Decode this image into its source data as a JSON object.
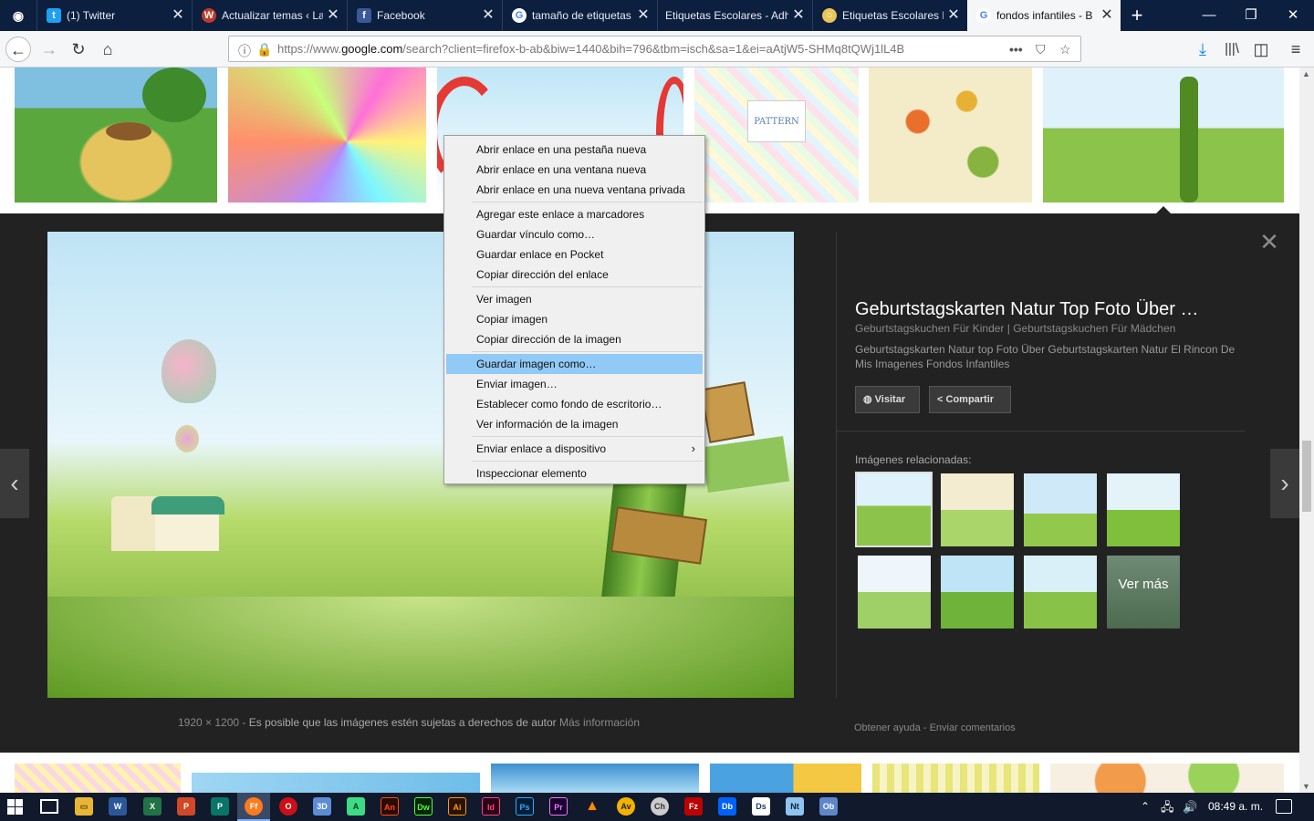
{
  "tabs": [
    {
      "title": "",
      "icon": "eye-icon"
    },
    {
      "title": "(1) Twitter",
      "icon": "twitter-bird-icon"
    },
    {
      "title": "Actualizar temas ‹ La",
      "icon": "wordpress-icon"
    },
    {
      "title": "Facebook",
      "icon": "facebook-icon"
    },
    {
      "title": "tamaño de etiquetas",
      "icon": "google-icon"
    },
    {
      "title": "Etiquetas Escolares - Adh",
      "icon": "blank-icon"
    },
    {
      "title": "Etiquetas Escolares P",
      "icon": "ring-icon"
    },
    {
      "title": "fondos infantiles - B",
      "icon": "google-icon"
    }
  ],
  "url": {
    "prefix": "https://www.",
    "domain": "google.com",
    "path": "/search?client=firefox-b-ab&biw=1440&bih=796&tbm=isch&sa=1&ei=aAtjW5-SHMq8tQWj1lL4B"
  },
  "context_menu": {
    "items": [
      "Abrir enlace en una pestaña nueva",
      "Abrir enlace en una ventana nueva",
      "Abrir enlace en una nueva ventana privada",
      "Agregar este enlace a marcadores",
      "Guardar vínculo como…",
      "Guardar enlace en Pocket",
      "Copiar dirección del enlace",
      "Ver imagen",
      "Copiar imagen",
      "Copiar dirección de la imagen",
      "Guardar imagen como…",
      "Enviar imagen…",
      "Establecer como fondo de escritorio…",
      "Ver información de la imagen",
      "Enviar enlace a dispositivo",
      "Inspeccionar elemento"
    ],
    "highlighted": "Guardar imagen como…"
  },
  "pattern_thumb_label": "PATTERN",
  "detail": {
    "title": "Geburtstagskarten Natur Top Foto Über …",
    "subtitle": "Geburtstagskuchen Für Kinder | Geburtstagskuchen Für Mädchen",
    "description": "Geburtstagskarten Natur top Foto Über Geburtstagskarten Natur El Rincon De Mis Imagenes Fondos Infantiles",
    "visit_label": "Visitar",
    "share_label": "Compartir",
    "related_label": "Imágenes relacionadas:",
    "more_label": "Ver más",
    "dimensions": "1920 × 1200",
    "copyright": "Es posible que las imágenes estén sujetas a derechos de autor",
    "more_info": "Más información",
    "help": "Obtener ayuda",
    "feedback": "Enviar comentarios"
  },
  "taskbar": {
    "clock": "08:49 a. m.",
    "apps": [
      "W",
      "X",
      "P",
      "P",
      "Ff",
      "O",
      "3D",
      "A",
      "An",
      "Dw",
      "Ai",
      "Id",
      "Ps",
      "Pr",
      "VLC",
      "Av",
      "Ch",
      "Fz",
      "Db",
      "Ds",
      "Nt",
      "Ob"
    ]
  }
}
